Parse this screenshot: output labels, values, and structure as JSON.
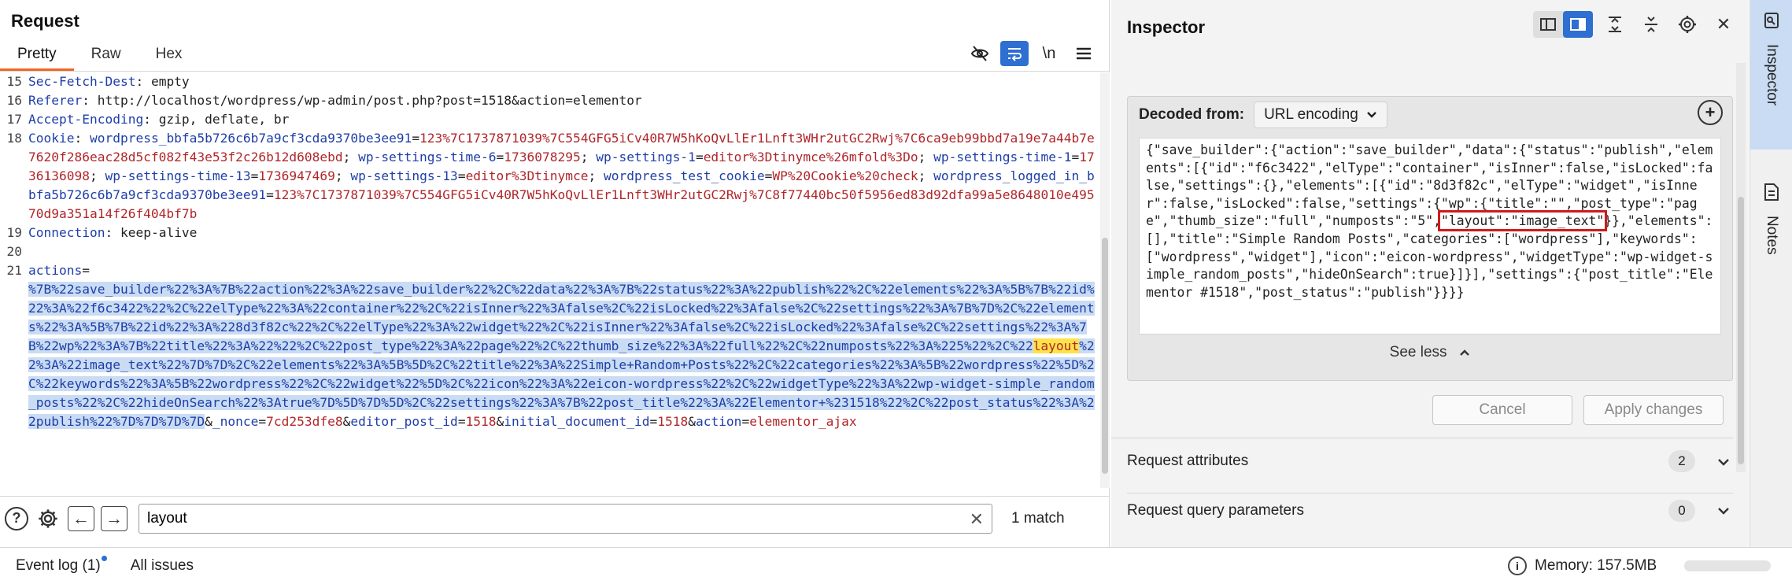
{
  "request": {
    "title": "Request",
    "tabs": [
      {
        "label": "Pretty",
        "active": true
      },
      {
        "label": "Raw",
        "active": false
      },
      {
        "label": "Hex",
        "active": false
      }
    ],
    "toolbar": {
      "hide_icon": "eye-slash-icon",
      "wrap_icon": "wrap-lines-icon",
      "newline_label": "\\n",
      "menu_icon": "hamburger-menu-icon"
    },
    "lines": {
      "l15": {
        "n": "15",
        "key": "Sec-Fetch-Dest",
        "val": "empty"
      },
      "l16": {
        "n": "16",
        "key": "Referer",
        "val": "http://localhost/wordpress/wp-admin/post.php?post=1518&action=elementor"
      },
      "l17": {
        "n": "17",
        "key": "Accept-Encoding",
        "val": "gzip, deflate, br"
      },
      "l18": {
        "n": "18",
        "key": "Cookie",
        "c1k": "wordpress_bbfa5b726c6b7a9cf3cda9370be3ee91",
        "c1v": "123%7C1737871039%7C554GFG5iCv40R7W5hKoQvLlEr1Lnft3WHr2utGC2Rwj%7C6ca9eb99bbd7a19e7a44b7e7620f286eac28d5cf082f43e53f2c26b12d608ebd",
        "c2k": "wp-settings-time-6",
        "c2v": "1736078295",
        "c3k": "wp-settings-1",
        "c3v": "editor%3Dtinymce%26mfold%3Do",
        "c4k": "wp-settings-time-1",
        "c4v": "1736136098",
        "c5k": "wp-settings-time-13",
        "c5v": "1736947469",
        "c6k": "wp-settings-13",
        "c6v": "editor%3Dtinymce",
        "c7k": "wordpress_test_cookie",
        "c7v": "WP%20Cookie%20check",
        "c8k": "wordpress_logged_in_bbfa5b726c6b7a9cf3cda9370be3ee91",
        "c8v": "123%7C1737871039%7C554GFG5iCv40R7W5hKoQvLlEr1Lnft3WHr2utGC2Rwj%7C8f77440bc50f5956ed83d92dfa99a5e8648010e49570d9a351a14f26f404bf7b"
      },
      "l19": {
        "n": "19",
        "key": "Connection",
        "val": "keep-alive"
      },
      "l20": {
        "n": "20"
      },
      "l21": {
        "n": "21",
        "param_key": "actions",
        "sel_before": "%7B%22save_builder%22%3A%7B%22action%22%3A%22save_builder%22%2C%22data%22%3A%7B%22status%22%3A%22publish%22%2C%22elements%22%3A%5B%7B%22id%22%3A%22f6c3422%22%2C%22elType%22%3A%22container%22%2C%22isInner%22%3Afalse%2C%22isLocked%22%3Afalse%2C%22settings%22%3A%7B%7D%2C%22elements%22%3A%5B%7B%22id%22%3A%228d3f82c%22%2C%22elType%22%3A%22widget%22%2C%22isInner%22%3Afalse%2C%22isLocked%22%3Afalse%2C%22settings%22%3A%7B%22wp%22%3A%7B%22title%22%3A%22%22%2C%22post_type%22%3A%22page%22%2C%22thumb_size%22%3A%22full%22%2C%22numposts%22%3A%225%22%2C%22",
        "match": "layout",
        "sel_after": "%22%3A%22image_text%22%7D%7D%2C%22elements%22%3A%5B%5D%2C%22title%22%3A%22Simple+Random+Posts%22%2C%22categories%22%3A%5B%22wordpress%22%5D%2C%22keywords%22%3A%5B%22wordpress%22%2C%22widget%22%5D%2C%22icon%22%3A%22eicon-wordpress%22%2C%22widgetType%22%3A%22wp-widget-simple_random_posts%22%2C%22hideOnSearch%22%3Atrue%7D%5D%7D%5D%2C%22settings%22%3A%7B%22post_title%22%3A%22Elementor+%231518%22%2C%22post_status%22%3A%22publish%22%7D%7D%7D%7D",
        "nonce_key": "_nonce",
        "nonce_val": "7cd253dfe8",
        "p2k": "editor_post_id",
        "p2v": "1518",
        "p3k": "initial_document_id",
        "p3v": "1518",
        "p4k": "action",
        "p4v": "elementor_ajax"
      }
    },
    "search": {
      "help_icon": "help-icon",
      "settings_icon": "gear-icon",
      "prev_icon": "arrow-left-icon",
      "next_icon": "arrow-right-icon",
      "value": "layout",
      "clear_icon": "close-icon",
      "match_count": "1 match"
    }
  },
  "inspector": {
    "title": "Inspector",
    "toolbar": [
      "layout-split-icon",
      "layout-columns-icon",
      "expand-icon",
      "collapse-icon",
      "gear-icon",
      "close-icon"
    ],
    "decoded": {
      "label": "Decoded from:",
      "encoding": "URL encoding",
      "text_before": "{\"save_builder\":{\"action\":\"save_builder\",\"data\":{\"status\":\"publish\",\"elements\":[{\"id\":\"f6c3422\",\"elType\":\"container\",\"isInner\":false,\"isLocked\":false,\"settings\":{},\"elements\":[{\"id\":\"8d3f82c\",\"elType\":\"widget\",\"isInner\":false,\"isLocked\":false,\"settings\":{\"wp\":{\"title\":\"\",\"post_type\":\"page\",\"thumb_size\":\"full\",\"numposts\":\"5\",",
      "text_boxed": "\"layout\":\"image_text\"",
      "text_after": "}},\"elements\":[],\"title\":\"Simple Random Posts\",\"categories\":[\"wordpress\"],\"keywords\":[\"wordpress\",\"widget\"],\"icon\":\"eicon-wordpress\",\"widgetType\":\"wp-widget-simple_random_posts\",\"hideOnSearch\":true}]}],\"settings\":{\"post_title\":\"Elementor #1518\",\"post_status\":\"publish\"}}}}",
      "see_less": "See less",
      "cancel": "Cancel",
      "apply": "Apply changes"
    },
    "sections": [
      {
        "label": "Request attributes",
        "count": "2"
      },
      {
        "label": "Request query parameters",
        "count": "0"
      }
    ]
  },
  "sidebar": {
    "tabs": [
      {
        "label": "Inspector",
        "icon": "inspector-icon",
        "active": true
      },
      {
        "label": "Notes",
        "icon": "notes-icon",
        "active": false
      }
    ]
  },
  "status_bar": {
    "event_log": "Event log (1)",
    "all_issues": "All issues",
    "memory": "Memory: 157.5MB"
  }
}
